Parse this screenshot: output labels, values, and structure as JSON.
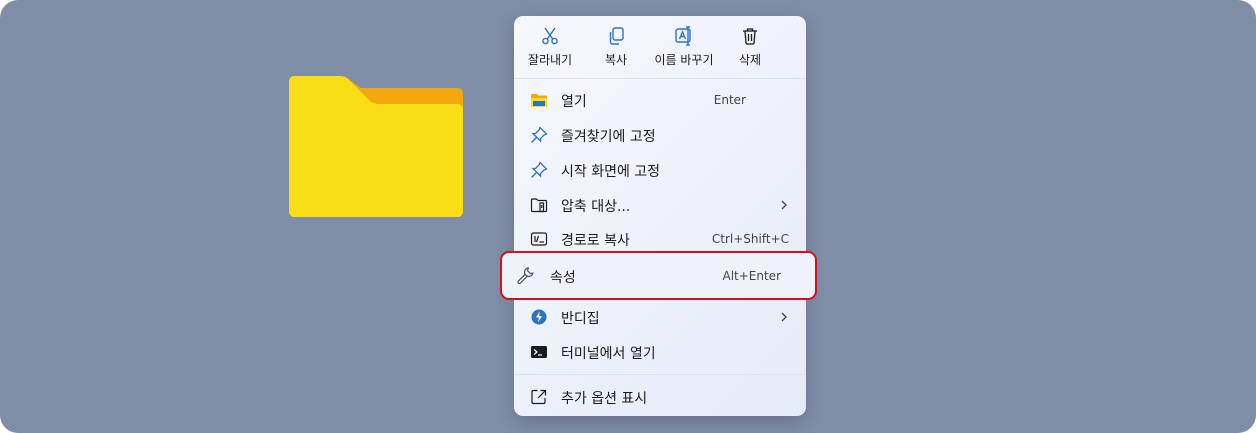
{
  "toolbar": {
    "cut": "잘라내기",
    "copy": "복사",
    "rename": "이름 바꾸기",
    "delete": "삭제"
  },
  "menu": {
    "open": {
      "label": "열기",
      "shortcut": "Enter"
    },
    "pin_quick_access": {
      "label": "즐겨찾기에 고정"
    },
    "pin_start": {
      "label": "시작 화면에 고정"
    },
    "compress": {
      "label": "압축 대상..."
    },
    "copy_path": {
      "label": "경로로 복사",
      "shortcut": "Ctrl+Shift+C"
    },
    "properties": {
      "label": "속성",
      "shortcut": "Alt+Enter"
    },
    "bandizip": {
      "label": "반디집"
    },
    "open_terminal": {
      "label": "터미널에서 열기"
    },
    "more_options": {
      "label": "추가 옵션 표시"
    }
  },
  "colors": {
    "desktop_background": "#7f8da7",
    "folder_front": "#f9de16",
    "folder_back": "#f3a80e",
    "highlight_border": "#d40f1e",
    "icon_blue": "#2c73c2"
  },
  "icons": {
    "folder": "folder-icon",
    "cut": "scissors-icon",
    "copy": "copy-icon",
    "rename": "rename-icon",
    "delete": "trash-icon",
    "properties": "wrench-icon",
    "bandizip": "bandizip-icon",
    "terminal": "terminal-icon"
  }
}
